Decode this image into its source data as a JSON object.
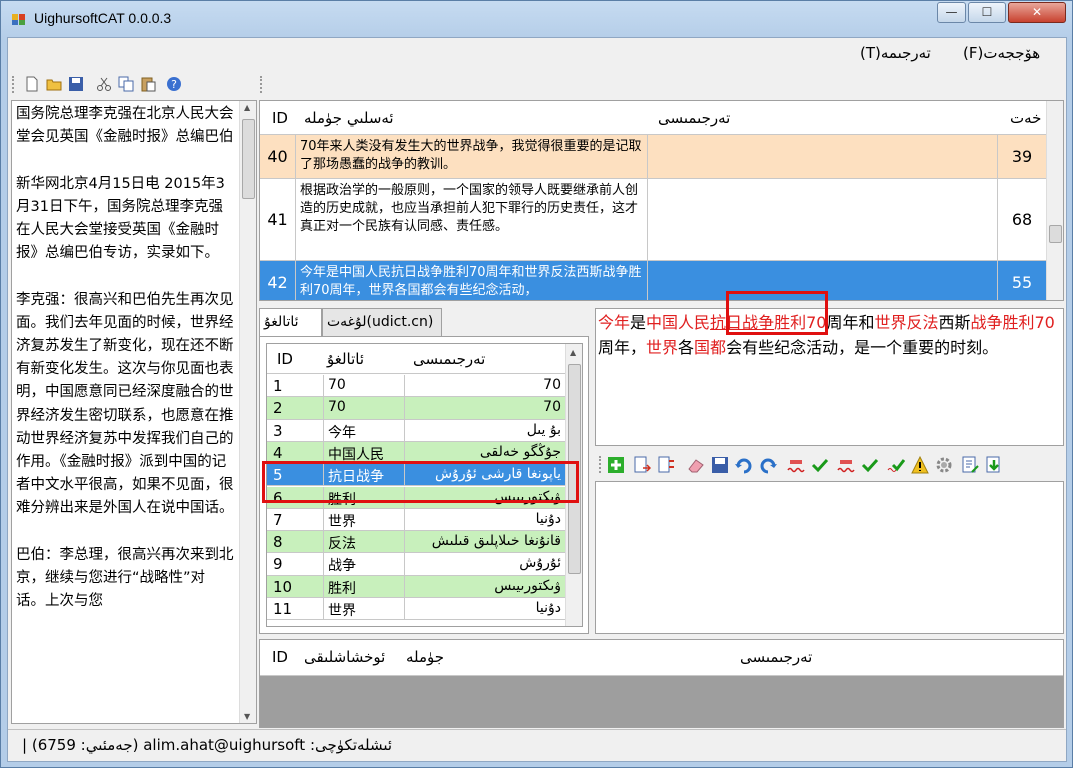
{
  "window": {
    "title": "UighursoftCAT 0.0.0.3",
    "minimize": "—",
    "maximize": "☐",
    "close": "✕"
  },
  "menu": {
    "file": "ھۆججەت(F)",
    "translate": "تەرجىمە(T)"
  },
  "source_text": "国务院总理李克强在北京人民大会堂会见英国《金融时报》总编巴伯\n\n新华网北京4月15日电 2015年3月31日下午，国务院总理李克强在人民大会堂接受英国《金融时报》总编巴伯专访，实录如下。\n\n李克强：很高兴和巴伯先生再次见面。我们去年见面的时候，世界经济复苏发生了新变化，现在还不断有新变化发生。这次与你见面也表明，中国愿意同已经深度融合的世界经济发生密切联系，也愿意在推动世界经济复苏中发挥我们自己的作用。《金融时报》派到中国的记者中文水平很高，如果不见面，很难分辨出来是外国人在说中国话。\n\n巴伯：李总理，很高兴再次来到北京，继续与您进行“战略性”对话。上次与您",
  "grid": {
    "headers": {
      "id": "ID",
      "source": "ئەسلىي جۈملە",
      "target": "تەرجىمىسى",
      "length": "خەت"
    },
    "rows": [
      {
        "id": "40",
        "source": "70年来人类没有发生大的世界战争，我觉得很重要的是记取了那场愚蠢的战争的教训。",
        "target": "",
        "length": "39"
      },
      {
        "id": "41",
        "source": "根据政治学的一般原则，一个国家的领导人既要继承前人创造的历史成就，也应当承担前人犯下罪行的历史责任，这才真正对一个民族有认同感、责任感。",
        "target": "",
        "length": "68"
      },
      {
        "id": "42",
        "source": "今年是中国人民抗日战争胜利70周年和世界反法西斯战争胜利70周年，世界各国都会有些纪念活动，",
        "target": "",
        "length": "55"
      }
    ]
  },
  "tabs": {
    "glossary": "ئاتالغۇ",
    "dictionary": "لۇغەت(udict.cn)"
  },
  "dict": {
    "headers": {
      "id": "ID",
      "term": "ئاتالغۇ",
      "translation": "تەرجىمىسى"
    },
    "rows": [
      {
        "id": "1",
        "term": "70",
        "translation": "70"
      },
      {
        "id": "2",
        "term": "70",
        "translation": "70"
      },
      {
        "id": "3",
        "term": "今年",
        "translation": "بۇ يىل"
      },
      {
        "id": "4",
        "term": "中国人民",
        "translation": "جۇڭگو خەلقى"
      },
      {
        "id": "5",
        "term": "抗日战争",
        "translation": "ياپونغا قارشى ئۇرۇش"
      },
      {
        "id": "6",
        "term": "胜利",
        "translation": "ۋىكتورىيىس"
      },
      {
        "id": "7",
        "term": "世界",
        "translation": "دۇنيا"
      },
      {
        "id": "8",
        "term": "反法",
        "translation": "قانۇنغا خىلاپلىق قىلىش"
      },
      {
        "id": "9",
        "term": "战争",
        "translation": "ئۇرۇش"
      },
      {
        "id": "10",
        "term": "胜利",
        "translation": "ۋىكتورىيىس"
      },
      {
        "id": "11",
        "term": "世界",
        "translation": "دۇنيا"
      }
    ]
  },
  "trans": {
    "seg1": "今年",
    "seg2": "是",
    "seg3": "中国人民",
    "seg4": "抗日战争",
    "seg5": "胜利",
    "seg6": "70",
    "seg7": "周年和",
    "seg8": "世界反法",
    "seg9": "西斯",
    "seg10": "战争胜利",
    "seg11": "70",
    "seg12": "周年，",
    "seg13": "世界",
    "seg14": "各",
    "seg15": "国都",
    "seg16": "会有些纪念活动，是一个重要的时刻。"
  },
  "bottom": {
    "headers": {
      "id": "ID",
      "similarity": "ئوخشاشلىقى",
      "sentence": "جۈملە",
      "translation": "تەرجىمىسى"
    }
  },
  "status": {
    "text": "ئىشلەتكۈچى: alim.ahat@uighursoft (جەمئىي: 6759) |"
  },
  "colors": {
    "row_orange": "#fde0c0",
    "row_selected": "#3a8fe0",
    "dict_alt": "#c8f0bc",
    "highlight_red": "#e02020"
  },
  "icons": [
    "new-icon",
    "open-icon",
    "save-icon",
    "cut-icon",
    "copy-icon",
    "paste-icon",
    "help-icon",
    "add-icon",
    "insert-icon",
    "merge-icon",
    "eraser-icon",
    "save-icon",
    "undo-icon",
    "redo-icon",
    "check-icon",
    "settings-icon",
    "warning-icon",
    "import-icon"
  ]
}
